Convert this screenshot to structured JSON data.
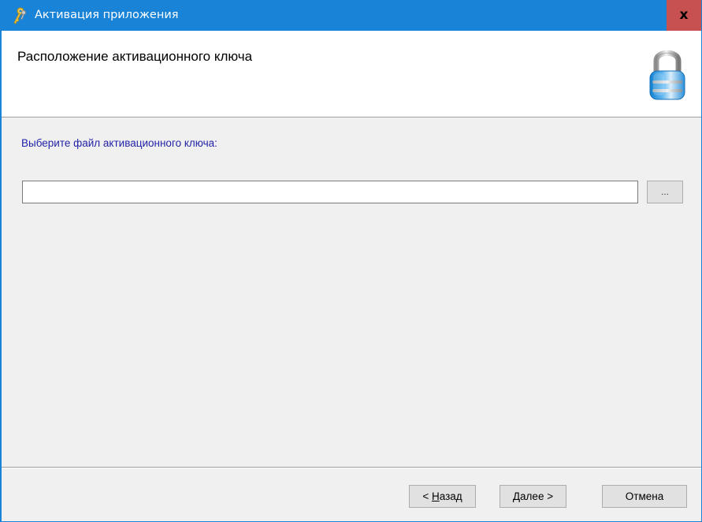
{
  "window": {
    "title": "Активация приложения",
    "close_label": "x"
  },
  "header": {
    "title": "Расположение активационного ключа",
    "icon": "padlock-icon"
  },
  "content": {
    "prompt": "Выберите файл активационного ключа:",
    "file_path": {
      "value": "",
      "placeholder": ""
    },
    "browse_label": "..."
  },
  "footer": {
    "back": {
      "prefix": "< ",
      "mnemonic": "Н",
      "rest": "азад"
    },
    "next": {
      "mnemonic": "Д",
      "rest": "алее >"
    },
    "cancel": "Отмена"
  },
  "colors": {
    "titlebar": "#1883d7",
    "close_hover": "#c75050",
    "prompt_text": "#2323a8",
    "dialog_bg": "#f0f0f0"
  }
}
